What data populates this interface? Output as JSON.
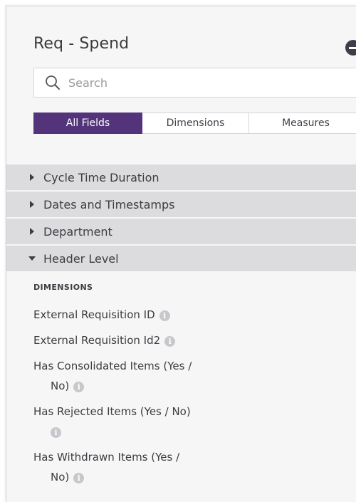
{
  "panel": {
    "title": "Req - Spend"
  },
  "search": {
    "placeholder": "Search",
    "value": ""
  },
  "tabs": [
    {
      "label": "All Fields",
      "active": true
    },
    {
      "label": "Dimensions",
      "active": false
    },
    {
      "label": "Measures",
      "active": false
    }
  ],
  "groups": [
    {
      "label": "Cycle Time Duration",
      "expanded": false
    },
    {
      "label": "Dates and Timestamps",
      "expanded": false
    },
    {
      "label": "Department",
      "expanded": false
    },
    {
      "label": "Header Level",
      "expanded": true
    }
  ],
  "header_level": {
    "section_label": "DIMENSIONS",
    "fields": [
      {
        "line1": "External Requisition ID",
        "line2": ""
      },
      {
        "line1": "External Requisition Id2",
        "line2": ""
      },
      {
        "line1": "Has Consolidated Items (Yes /",
        "line2": "No)"
      },
      {
        "line1": "Has Rejected Items (Yes / No)",
        "line2": ""
      },
      {
        "line1": "Has Withdrawn Items (Yes /",
        "line2": "No)"
      }
    ]
  },
  "colors": {
    "accent": "#53347a",
    "group_bg": "#dcdcdf",
    "panel_bg": "#f6f6f7"
  },
  "icons": {
    "search": "search-icon",
    "collapse": "minus-circle-icon",
    "collapsed_group": "caret-right-icon",
    "expanded_group": "caret-down-icon",
    "info": "info-icon"
  }
}
